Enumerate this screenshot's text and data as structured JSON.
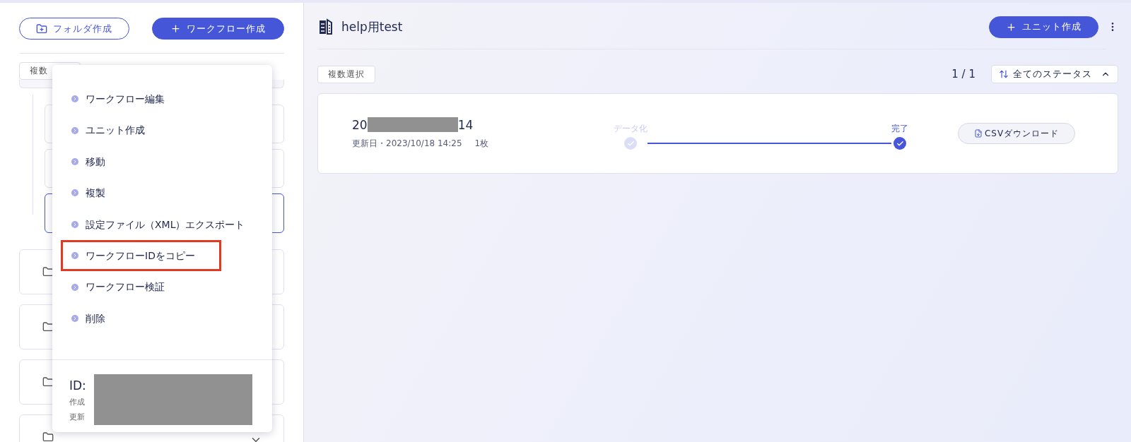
{
  "left_panel": {
    "buttons": [
      {
        "label": "フォルダ作成",
        "kind": "outline"
      },
      {
        "label": "ワークフロー作成",
        "kind": "primary"
      }
    ],
    "multi_select": "複数",
    "nested_cards": [
      {
        "selected": false
      },
      {
        "selected": false
      },
      {
        "selected": true
      }
    ],
    "folder_cards": [
      {
        "expandable": false
      },
      {
        "expandable": false
      },
      {
        "expandable": false
      },
      {
        "expandable": true
      }
    ]
  },
  "context_menu": {
    "items": [
      {
        "label": "ワークフロー編集",
        "highlighted": false
      },
      {
        "label": "ユニット作成",
        "highlighted": false
      },
      {
        "label": "移動",
        "highlighted": false
      },
      {
        "label": "複製",
        "highlighted": false
      },
      {
        "label": "設定ファイル（XML）エクスポート",
        "highlighted": false
      },
      {
        "label": "ワークフローIDをコピー",
        "highlighted": true
      },
      {
        "label": "ワークフロー検証",
        "highlighted": false
      },
      {
        "label": "削除",
        "highlighted": false
      }
    ],
    "info": {
      "id_label": "ID:",
      "created_label": "作成",
      "updated_label": "更新"
    }
  },
  "main": {
    "title": "help用test",
    "create_unit_button": "ユニット作成",
    "multi_select": "複数選択",
    "page_count": "1 / 1",
    "status_filter": "全てのステータス",
    "units": [
      {
        "name_start": "20",
        "name_end": "14",
        "meta": "更新日・2023/10/18 14:25",
        "pages": "1枚",
        "download": "CSVダウンロード",
        "steps": [
          {
            "label": "データ化",
            "active": false
          },
          {
            "label": "完了",
            "active": true
          }
        ]
      }
    ]
  }
}
